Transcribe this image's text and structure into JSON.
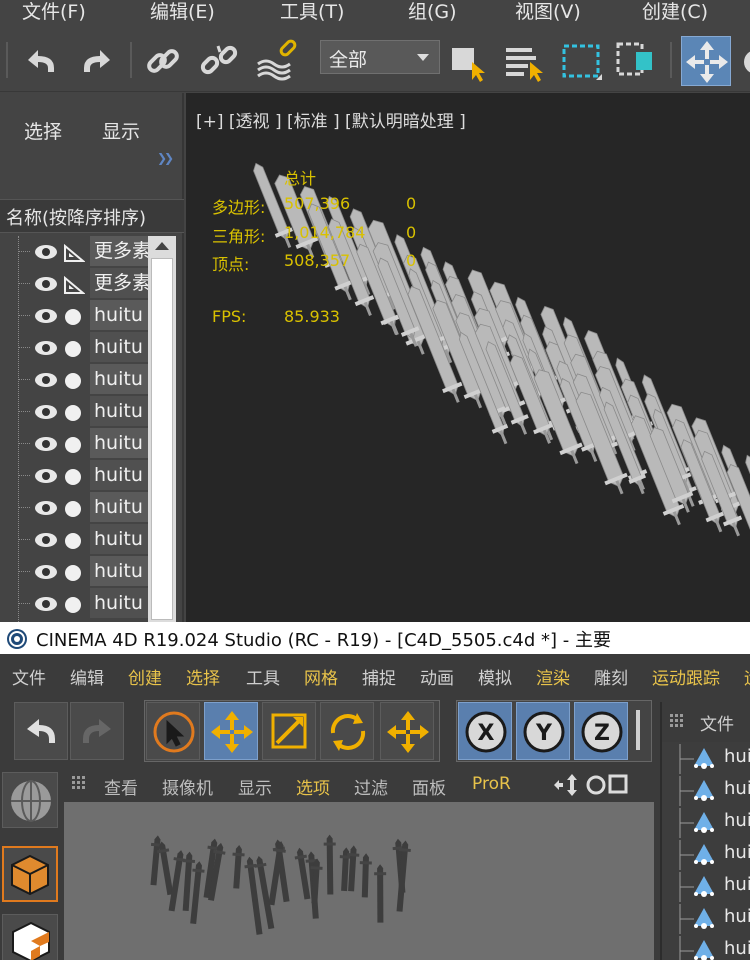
{
  "max": {
    "menus": [
      "文件(F)",
      "编辑(E)",
      "工具(T)",
      "组(G)",
      "视图(V)",
      "创建(C)"
    ],
    "selection_filter": "全部",
    "scene_tabs": [
      "选择",
      "显示"
    ],
    "scene_header": "名称(按降序排序)",
    "scene_items": [
      {
        "name": "更多素",
        "type": "bone"
      },
      {
        "name": "更多素",
        "type": "bone"
      },
      {
        "name": "huitu",
        "type": "sphere"
      },
      {
        "name": "huitu",
        "type": "sphere"
      },
      {
        "name": "huitu",
        "type": "sphere"
      },
      {
        "name": "huitu",
        "type": "sphere"
      },
      {
        "name": "huitu",
        "type": "sphere"
      },
      {
        "name": "huitu",
        "type": "sphere"
      },
      {
        "name": "huitu",
        "type": "sphere"
      },
      {
        "name": "huitu",
        "type": "sphere"
      },
      {
        "name": "huitu",
        "type": "sphere"
      },
      {
        "name": "huitu",
        "type": "sphere"
      }
    ],
    "viewport_label": "[+] [透视 ] [标准 ] [默认明暗处理 ]",
    "stats": {
      "total_label": "总计",
      "rows": [
        {
          "label": "多边形:",
          "value": "507,396",
          "extra": "0"
        },
        {
          "label": "三角形:",
          "value": "1,014,784",
          "extra": "0"
        },
        {
          "label": "顶点:",
          "value": "508,357",
          "extra": "0"
        }
      ],
      "fps_label": "FPS:",
      "fps_value": "85.933"
    }
  },
  "c4d": {
    "title": "CINEMA 4D R19.024 Studio (RC - R19) - [C4D_5505.c4d *] - 主要",
    "menus": [
      {
        "label": "文件",
        "color": "#cfcfcf"
      },
      {
        "label": "编辑",
        "color": "#cfcfcf"
      },
      {
        "label": "创建",
        "color": "#e8c34a"
      },
      {
        "label": "选择",
        "color": "#e8c34a"
      },
      {
        "label": "工具",
        "color": "#cfcfcf"
      },
      {
        "label": "网格",
        "color": "#e8c34a"
      },
      {
        "label": "捕捉",
        "color": "#cfcfcf"
      },
      {
        "label": "动画",
        "color": "#cfcfcf"
      },
      {
        "label": "模拟",
        "color": "#cfcfcf"
      },
      {
        "label": "渲染",
        "color": "#e8c34a"
      },
      {
        "label": "雕刻",
        "color": "#cfcfcf"
      },
      {
        "label": "运动跟踪",
        "color": "#e8c34a"
      },
      {
        "label": "运",
        "color": "#e8c34a"
      }
    ],
    "axis_labels": [
      "X",
      "Y",
      "Z"
    ],
    "viewport_menus": [
      {
        "label": "查看",
        "color": "#bdbdbd"
      },
      {
        "label": "摄像机",
        "color": "#bdbdbd"
      },
      {
        "label": "显示",
        "color": "#bdbdbd"
      },
      {
        "label": "选项",
        "color": "#e8c34a"
      },
      {
        "label": "过滤",
        "color": "#bdbdbd"
      },
      {
        "label": "面板",
        "color": "#bdbdbd"
      },
      {
        "label": "ProR",
        "color": "#e8c34a"
      }
    ],
    "object_manager_header": "文件",
    "objects": [
      "huit",
      "huit",
      "huit",
      "huit",
      "huit",
      "huit",
      "huit"
    ]
  }
}
